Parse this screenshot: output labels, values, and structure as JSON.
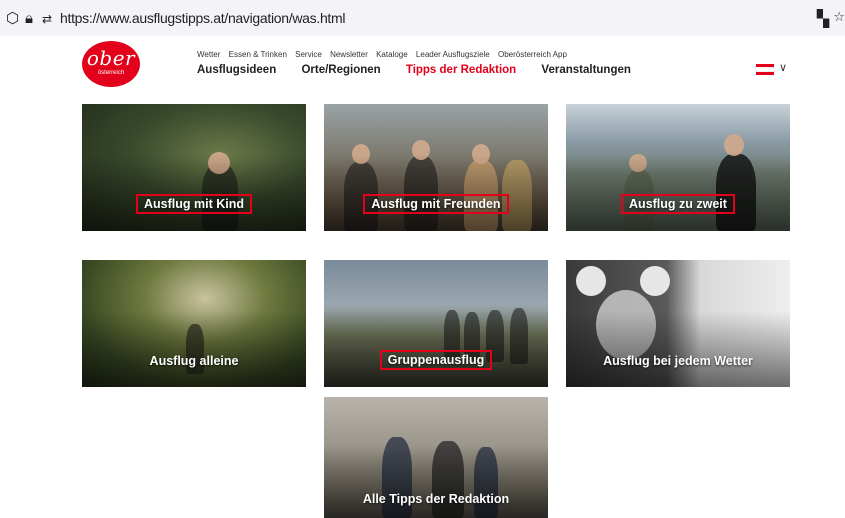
{
  "browser": {
    "url": "https://www.ausflugstipps.at/navigation/was.html",
    "icons": [
      "shield-icon",
      "lock-icon",
      "permissions-icon",
      "qr-code-icon",
      "bookmark-star-icon"
    ]
  },
  "logo": {
    "main": "ober",
    "sub": "österreich"
  },
  "top_nav": [
    "Wetter",
    "Essen & Trinken",
    "Service",
    "Newsletter",
    "Kataloge",
    "Leader Ausflugsziele",
    "Oberösterreich App"
  ],
  "main_nav": [
    {
      "label": "Ausflugsideen",
      "active": false
    },
    {
      "label": "Orte/Regionen",
      "active": false
    },
    {
      "label": "Tipps der Redaktion",
      "active": true
    },
    {
      "label": "Veranstaltungen",
      "active": false
    }
  ],
  "language": {
    "flag": "austria-flag-icon",
    "chevron": "chevron-down-icon"
  },
  "tiles": [
    {
      "label": "Ausflug mit Kind",
      "highlighted": true
    },
    {
      "label": "Ausflug mit Freunden",
      "highlighted": true
    },
    {
      "label": "Ausflug zu zweit",
      "highlighted": true
    },
    {
      "label": "Ausflug alleine",
      "highlighted": false
    },
    {
      "label": "Gruppenausflug",
      "highlighted": true
    },
    {
      "label": "Ausflug bei jedem Wetter",
      "highlighted": false
    },
    {
      "label": "Alle Tipps der Redaktion",
      "highlighted": false
    }
  ],
  "colors": {
    "brand_red": "#e2001a",
    "text": "#222222",
    "flag_red": "#e2001a",
    "flag_white": "#ffffff"
  }
}
